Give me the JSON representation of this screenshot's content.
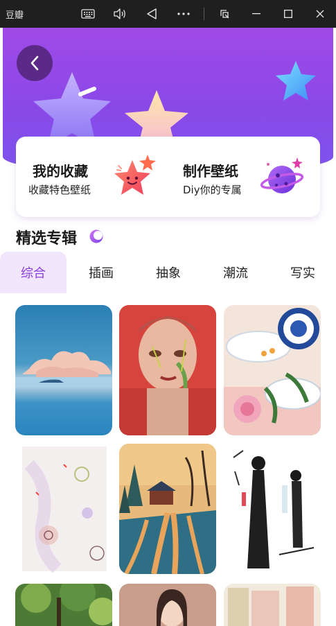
{
  "window": {
    "app_title": "豆瓣"
  },
  "titlebar_icons": [
    "keyboard-icon",
    "volume-icon",
    "back-triangle-icon",
    "more-icon",
    "snap-icon",
    "minimize-icon",
    "maximize-icon",
    "close-icon"
  ],
  "features": {
    "collect": {
      "title": "我的收藏",
      "subtitle": "收藏特色壁纸",
      "icon": "smiling-star-icon"
    },
    "diy": {
      "title": "制作壁纸",
      "subtitle": "Diy你的专属",
      "icon": "planet-icon"
    }
  },
  "section": {
    "title": "精选专辑"
  },
  "tabs": [
    {
      "label": "综合",
      "active": true
    },
    {
      "label": "插画",
      "active": false
    },
    {
      "label": "抽象",
      "active": false
    },
    {
      "label": "潮流",
      "active": false
    },
    {
      "label": "写实",
      "active": false
    }
  ],
  "colors": {
    "hero_top": "#a04ae6",
    "hero_bottom": "#7d55ee",
    "accent": "#8a3de0",
    "tab_active_bg": "#f1e6fc"
  },
  "wallpapers": [
    {
      "name": "whale-in-sea"
    },
    {
      "name": "painted-face-portrait"
    },
    {
      "name": "porcelain-bowls-flowers"
    },
    {
      "name": "abstract-watercolor"
    },
    {
      "name": "snowy-road-village"
    },
    {
      "name": "ink-sketch-couple"
    },
    {
      "name": "green-forest"
    },
    {
      "name": "anime-girl-portrait"
    },
    {
      "name": "pastel-abstract"
    }
  ]
}
